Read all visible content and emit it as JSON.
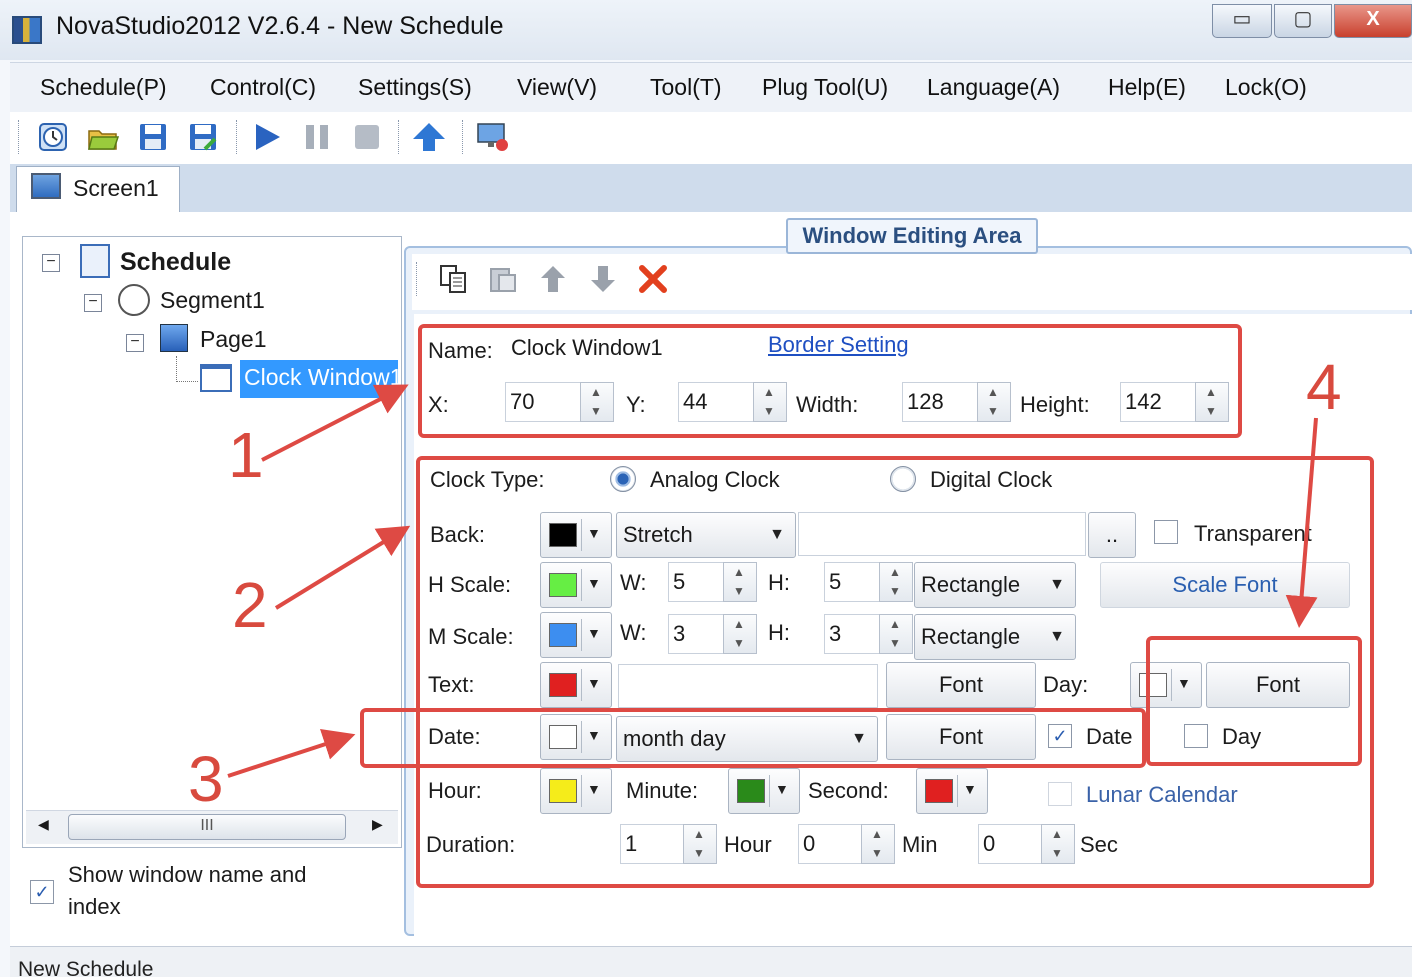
{
  "window": {
    "title": "NovaStudio2012 V2.6.4 - New Schedule",
    "min": "▭",
    "max": "▢",
    "close": "X"
  },
  "menu": [
    "Schedule(P)",
    "Control(C)",
    "Settings(S)",
    "View(V)",
    "Tool(T)",
    "Plug Tool(U)",
    "Language(A)",
    "Help(E)",
    "Lock(O)"
  ],
  "toolbar": {
    "icons": [
      "clock-icon",
      "open-folder-icon",
      "save-icon",
      "save-as-icon",
      "play-icon",
      "pause-icon",
      "stop-icon",
      "upload-icon",
      "screen-settings-icon"
    ]
  },
  "tabs": [
    {
      "label": "Screen1"
    }
  ],
  "tree": {
    "schedule": "Schedule",
    "segment": "Segment1",
    "page": "Page1",
    "window": "Clock Window1",
    "scroll_grip": "III"
  },
  "show_window_name": {
    "label_line1": "Show window name and",
    "label_line2": "index",
    "checked": true
  },
  "editing_area": {
    "title": "Window Editing Area"
  },
  "edit_toolbar": {
    "icons": [
      "copy-icon",
      "paste-icon",
      "move-up-icon",
      "move-down-icon",
      "delete-icon"
    ]
  },
  "props": {
    "name_label": "Name:",
    "name_value": "Clock Window1",
    "border_link": "Border Setting",
    "x_label": "X:",
    "x": "70",
    "y_label": "Y:",
    "y": "44",
    "width_label": "Width:",
    "width": "128",
    "height_label": "Height:",
    "height": "142"
  },
  "clock": {
    "type_label": "Clock Type:",
    "analog": "Analog Clock",
    "digital": "Digital Clock",
    "selected": "Analog Clock",
    "back_label": "Back:",
    "back_color": "#000000",
    "back_mode": "Stretch",
    "browse": "..",
    "transparent": "Transparent",
    "hscale_label": "H Scale:",
    "hscale_color": "#66ee44",
    "hscale_w_label": "W:",
    "hscale_w": "5",
    "hscale_h_label": "H:",
    "hscale_h": "5",
    "hscale_shape": "Rectangle",
    "scale_font": "Scale Font",
    "mscale_label": "M Scale:",
    "mscale_color": "#3d8ef0",
    "mscale_w_label": "W:",
    "mscale_w": "3",
    "mscale_h_label": "H:",
    "mscale_h": "3",
    "mscale_shape": "Rectangle",
    "text_label": "Text:",
    "text_color": "#e02020",
    "text_value": "",
    "text_font": "Font",
    "day_label": "Day:",
    "day_color": "#ffffff",
    "day_font": "Font",
    "date_label": "Date:",
    "date_color": "#ffffff",
    "date_format": "month day",
    "date_font": "Font",
    "date_check": "Date",
    "date_checked": true,
    "day_check": "Day",
    "day_checked": false,
    "hour_label": "Hour:",
    "hour_color": "#f5ec1a",
    "minute_label": "Minute:",
    "minute_color": "#2a8a1a",
    "second_label": "Second:",
    "second_color": "#e02020",
    "lunar": "Lunar Calendar",
    "duration_label": "Duration:",
    "dur_hour": "1",
    "hour_unit": "Hour",
    "dur_min": "0",
    "min_unit": "Min",
    "dur_sec": "0",
    "sec_unit": "Sec"
  },
  "annotations": [
    "1",
    "2",
    "3",
    "4"
  ],
  "status": "New Schedule"
}
